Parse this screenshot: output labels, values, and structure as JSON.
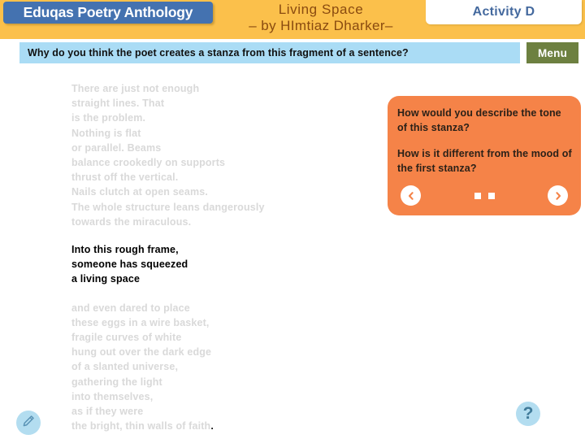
{
  "header": {
    "brand_label": "Eduqas Poetry Anthology",
    "poem_title_line1": "Living Space",
    "poem_title_line2": "– by HImtiaz Dharker–",
    "activity_label": "Activity D",
    "brand_color": "#4472b0",
    "bar_color": "#fbc04b",
    "title_color": "#8a4b10"
  },
  "question_bar": {
    "text": "Why do you think the poet creates a stanza from this fragment of a sentence?",
    "background_color": "#aadcf5"
  },
  "menu": {
    "label": "Menu",
    "background_color": "#6d8040"
  },
  "poem": {
    "stanza_one": [
      "There are just not enough",
      "straight lines.  That",
      "is the problem.",
      "Nothing is flat",
      "or parallel.  Beams",
      "balance crookedly on supports",
      "thrust off the vertical.",
      "Nails clutch at open seams.",
      "The whole structure leans dangerously",
      "towards the miraculous."
    ],
    "stanza_two": [
      "Into this rough frame,",
      "someone has squeezed",
      "a living space"
    ],
    "stanza_three": [
      "and even dared to place",
      "these eggs in a wire basket,",
      "fragile curves of white",
      "hung out over the dark edge",
      "of a slanted universe,",
      "gathering the light",
      "into themselves,",
      "as if they were",
      "the bright, thin walls of faith"
    ],
    "stanza_three_final_punctuation": ".",
    "faded_color": "#d9d9d9",
    "active_color": "#000000"
  },
  "prompt_panel": {
    "question_one": "How would you describe the tone of this stanza?",
    "question_two": "How is it different from the mood of the first stanza?",
    "background_color": "#f58348",
    "prev_icon": "chevron-left-icon",
    "next_icon": "chevron-right-icon",
    "dot_count": 2
  },
  "tools": {
    "pencil_icon": "pencil-icon",
    "help_icon": "question-mark-icon",
    "help_label": "?",
    "icon_background_color": "#b3ddf0"
  }
}
